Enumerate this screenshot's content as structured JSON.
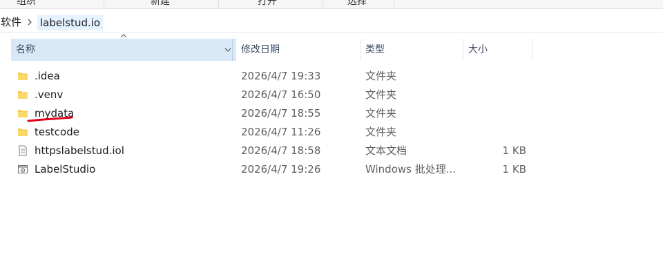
{
  "ribbon": {
    "items": [
      "组织",
      "新建",
      "打开",
      "选择"
    ]
  },
  "breadcrumb": {
    "root": "软件",
    "current": "labelstud.io"
  },
  "columns": {
    "name": "名称",
    "modified": "修改日期",
    "type": "类型",
    "size": "大小"
  },
  "files": [
    {
      "name": ".idea",
      "modified": "2026/4/7 19:33",
      "type": "文件夹",
      "size": "",
      "icon": "folder-icon"
    },
    {
      "name": ".venv",
      "modified": "2026/4/7 16:50",
      "type": "文件夹",
      "size": "",
      "icon": "folder-icon"
    },
    {
      "name": "mydata",
      "modified": "2026/4/7 18:55",
      "type": "文件夹",
      "size": "",
      "icon": "folder-icon"
    },
    {
      "name": "testcode",
      "modified": "2026/4/7 11:26",
      "type": "文件夹",
      "size": "",
      "icon": "folder-icon"
    },
    {
      "name": "httpslabelstud.iol",
      "modified": "2026/4/7 18:58",
      "type": "文本文档",
      "size": "1 KB",
      "icon": "text-document-icon"
    },
    {
      "name": "LabelStudio",
      "modified": "2026/4/7 19:26",
      "type": "Windows 批处理...",
      "size": "1 KB",
      "icon": "batch-file-icon"
    }
  ],
  "colors": {
    "folder": "#f8c94a",
    "header_selected": "#d8e8f7",
    "annotation": "#e0001b"
  }
}
